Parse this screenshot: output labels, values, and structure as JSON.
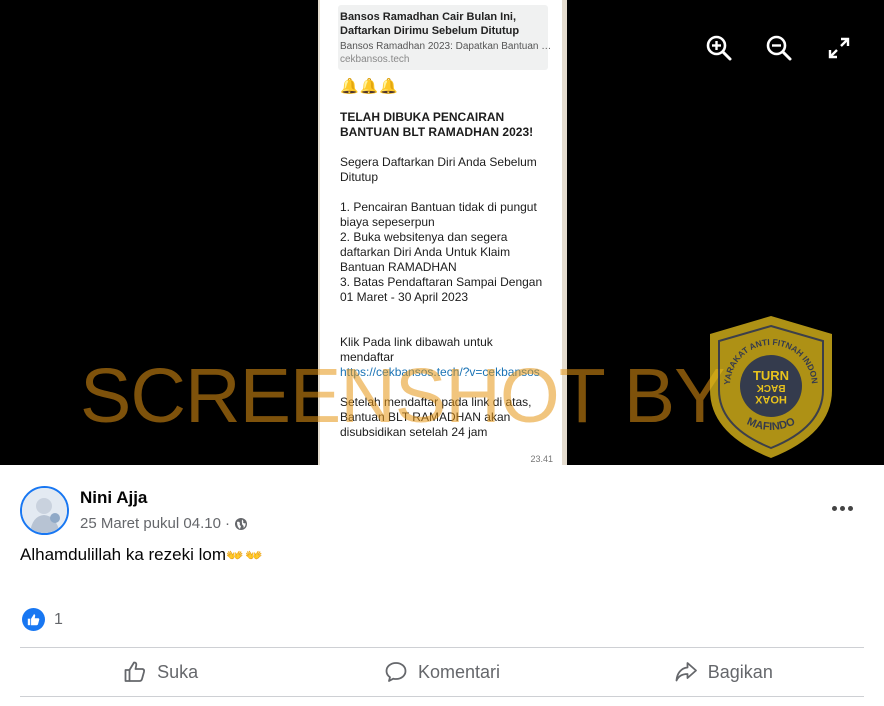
{
  "viewer": {
    "tools": [
      {
        "icon": "zoom-in-icon"
      },
      {
        "icon": "zoom-out-icon"
      },
      {
        "icon": "fullscreen-icon"
      }
    ]
  },
  "screenshot_content": {
    "preview_title": "Bansos Ramadhan Cair Bulan Ini, Daftarkan Dirimu Sebelum Ditutup",
    "preview_desc": "Bansos Ramadhan 2023: Dapatkan Bantuan Ban...",
    "preview_domain": "cekbansos.tech",
    "bells": "🔔🔔🔔",
    "heading": "TELAH DIBUKA PENCAIRAN BANTUAN BLT RAMADHAN 2023!",
    "line1": "Segera Daftarkan Diri Anda Sebelum Ditutup",
    "point1": "1. Pencairan Bantuan tidak di pungut biaya sepeserpun",
    "point2": "2. Buka websitenya dan segera daftarkan Diri Anda Untuk Klaim Bantuan RAMADHAN",
    "point3": "3. Batas Pendaftaran Sampai Dengan 01 Maret - 30 April 2023",
    "link_intro": "Klik Pada link dibawah untuk mendaftar",
    "link": "https://cekbansos.tech/?v=cekbansos",
    "closing": "Setelah mendaftar pada link di atas, Bantuan BLT RAMADHAN akan disubsidikan setelah 24 jam",
    "time": "23.41"
  },
  "watermark": {
    "text": "SCREENSHOT BY",
    "seal_top": "MASYARAKAT ANTI FITNAH INDONESIA",
    "seal_center": "TURN BACK HOAX",
    "seal_bottom": "MAFINDO"
  },
  "post": {
    "author": "Nini Ajja",
    "timestamp": "25 Maret pukul 04.10",
    "separator": "·",
    "audience_icon": "globe-icon",
    "caption": "Alhamdulillah ka rezeki lom",
    "caption_emoji": "👐👐",
    "reaction_count": "1",
    "actions": {
      "like": "Suka",
      "comment": "Komentari",
      "share": "Bagikan"
    }
  },
  "colors": {
    "accent": "#1877f2",
    "watermark": "#e69614",
    "link": "#1a73b5",
    "seal_yellow": "#e8c21c",
    "seal_navy": "#1f2b57"
  }
}
